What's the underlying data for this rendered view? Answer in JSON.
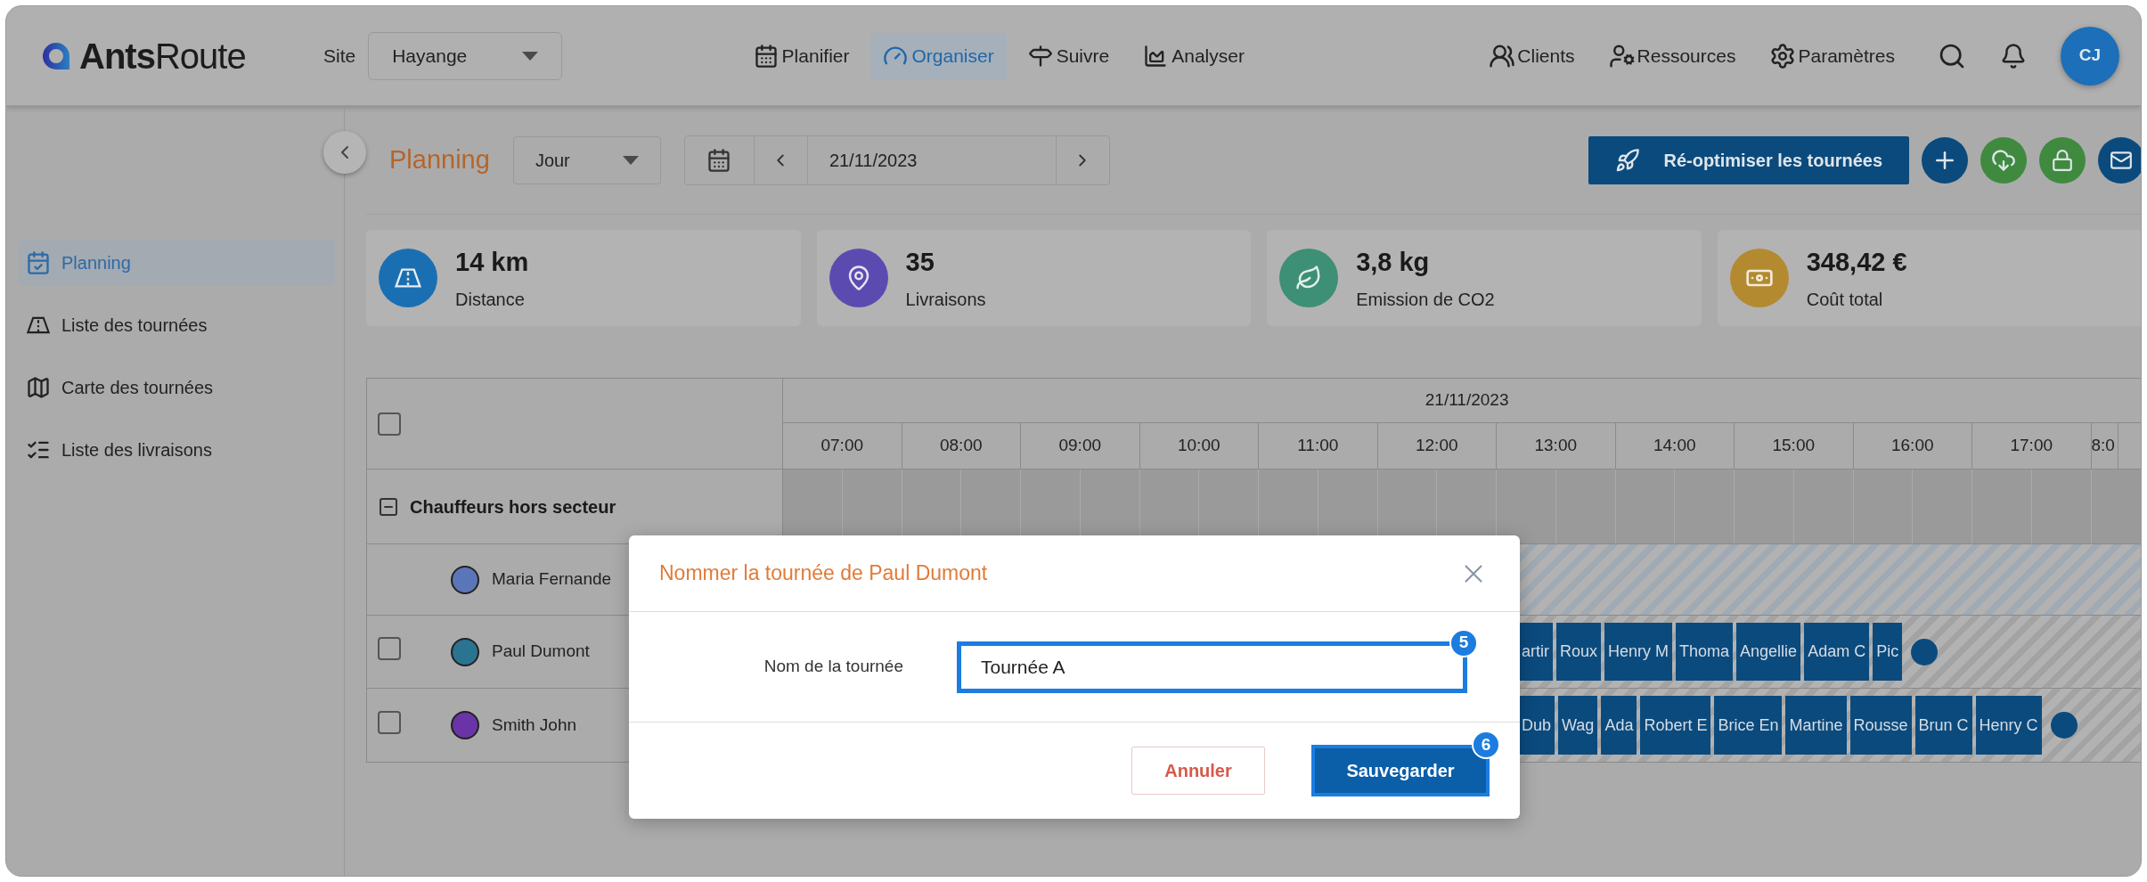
{
  "header": {
    "logo": "**Ants**Route",
    "site_label": "Site",
    "site_value": "Hayange",
    "nav": [
      {
        "label": "Planifier",
        "selected": false
      },
      {
        "label": "Organiser",
        "selected": true
      },
      {
        "label": "Suivre",
        "selected": false
      },
      {
        "label": "Analyser",
        "selected": false
      }
    ],
    "tools": [
      {
        "label": "Clients"
      },
      {
        "label": "Ressources"
      },
      {
        "label": "Paramètres"
      }
    ],
    "avatar": "CJ"
  },
  "sidebar": {
    "items": [
      {
        "label": "Planning",
        "selected": true
      },
      {
        "label": "Liste des tournées",
        "selected": false
      },
      {
        "label": "Carte des tournées",
        "selected": false
      },
      {
        "label": "Liste des livraisons",
        "selected": false
      }
    ]
  },
  "toolbar": {
    "title": "Planning",
    "view": "Jour",
    "date": "21/11/2023",
    "action": "Ré-optimiser les tournées"
  },
  "stats": [
    {
      "value": "14 km",
      "label": "Distance",
      "color": "#1a6fb3"
    },
    {
      "value": "35",
      "label": "Livraisons",
      "color": "#5b4bb0"
    },
    {
      "value": "3,8 kg",
      "label": "Emission de CO2",
      "color": "#3d8f75"
    },
    {
      "value": "348,42 €",
      "label": "Coût total",
      "color": "#b38a2f"
    }
  ],
  "gantt": {
    "select_all_checked": false,
    "date": "21/11/2023",
    "hours": [
      "07:00",
      "08:00",
      "09:00",
      "10:00",
      "11:00",
      "12:00",
      "13:00",
      "14:00",
      "15:00",
      "16:00",
      "17:00",
      "8:0"
    ],
    "group": {
      "label": "Chauffeurs hors secteur",
      "expanded": true
    },
    "drivers": [
      {
        "kind": "unassigned",
        "name": "Maria Fernande",
        "color": "#5b76b8"
      },
      {
        "kind": "route",
        "name": "Paul Dumont",
        "color": "#2a7391",
        "checked": false,
        "stops": [
          "artir",
          "Roux",
          "Henry M",
          "Thoma",
          "Angellie",
          "Adam C",
          "Pic"
        ]
      },
      {
        "kind": "route",
        "name": "Smith John",
        "color": "#6a34a6",
        "checked": false,
        "stops": [
          "Dub",
          "Wag",
          "Ada",
          "Robert E",
          "Brice En",
          "Martine",
          "Rousse",
          "Brun C",
          "Henry C"
        ]
      }
    ]
  },
  "dialog": {
    "title": "Nommer la tournée de Paul Dumont",
    "field_label": "Nom de la tournée",
    "value": "Tournée A",
    "field_badge": "5",
    "cancel": "Annuler",
    "save": "Sauvegarder",
    "save_badge": "6"
  }
}
